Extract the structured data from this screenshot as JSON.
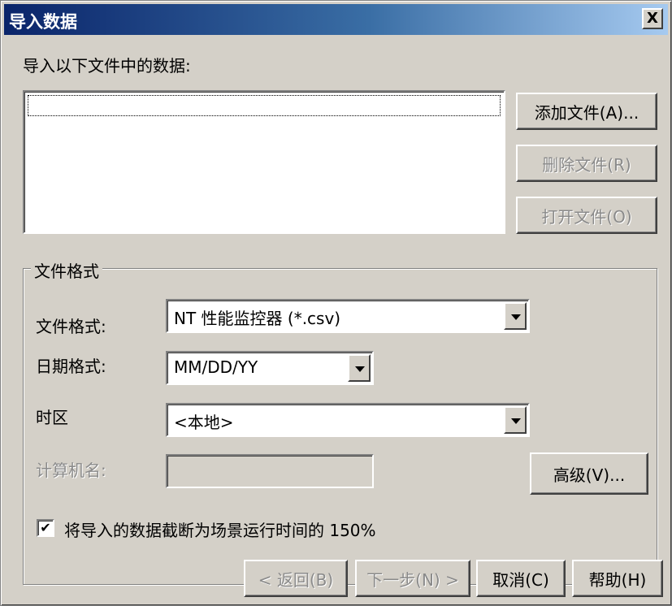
{
  "window": {
    "title": "导入数据",
    "close_glyph": "X"
  },
  "import": {
    "label": "导入以下文件中的数据:",
    "add_file_label": "添加文件(A)...",
    "remove_file_label": "删除文件(R)",
    "open_file_label": "打开文件(O)"
  },
  "format_group": {
    "title": "文件格式",
    "file_format_label": "文件格式:",
    "file_format_value": "NT 性能监控器 (*.csv)",
    "date_format_label": "日期格式:",
    "date_format_value": "MM/DD/YY",
    "timezone_label": "时区",
    "timezone_value": "<本地>",
    "computer_name_label": "计算机名:",
    "computer_name_value": "",
    "advanced_label": "高级(V)...",
    "truncate_checked": true,
    "truncate_check_glyph": "✔",
    "truncate_label": "将导入的数据截断为场景运行时间的 150%"
  },
  "footer": {
    "back_label": "< 返回(B)",
    "next_label": "下一步(N) >",
    "cancel_label": "取消(C)",
    "help_label": "帮助(H)"
  }
}
